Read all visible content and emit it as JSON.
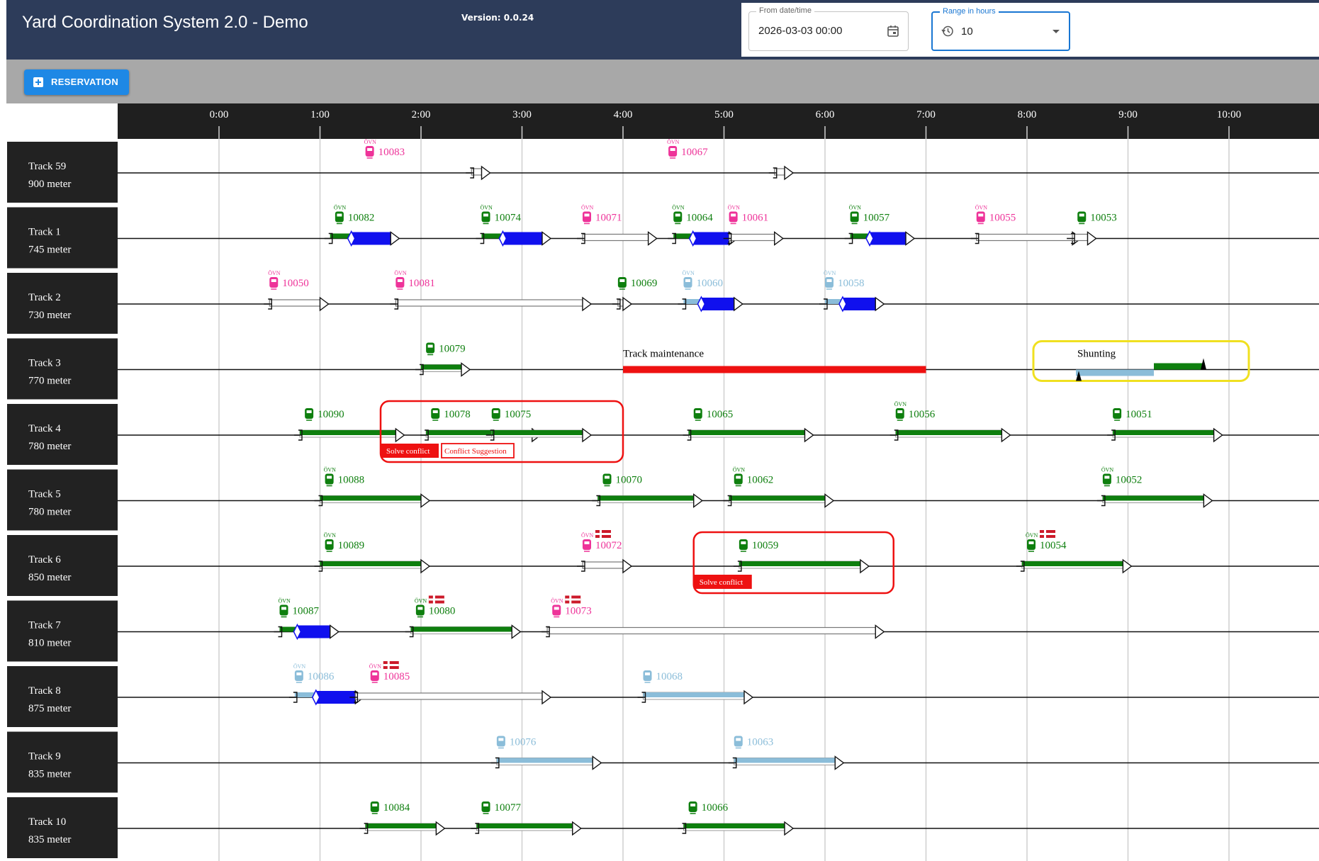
{
  "app": {
    "title": "Yard Coordination System 2.0 - Demo",
    "version": "Version: 0.0.24"
  },
  "controls": {
    "from_label": "From date/time",
    "from_value": "2026-03-03 00:00",
    "range_label": "Range in hours",
    "range_value": "10",
    "reservation_label": "RESERVATION"
  },
  "colors": {
    "header": "#2d3c5a",
    "toolbar": "#a8a8a8",
    "green": "#0e7f0e",
    "blue": "#1010ee",
    "lightblue": "#8bbdd9",
    "pink": "#ee3399",
    "red": "#ee1111",
    "yellow": "#f0e020",
    "tracklabel": "#222222"
  },
  "timeline": {
    "ticks": [
      "0:00",
      "1:00",
      "2:00",
      "3:00",
      "4:00",
      "5:00",
      "6:00",
      "7:00",
      "8:00",
      "9:00",
      "10:00"
    ],
    "start_hour": 0,
    "hours": 11
  },
  "tracks": [
    {
      "name": "Track 59",
      "length": "900 meter",
      "items": [
        {
          "id": "10083",
          "color": "pink",
          "ovn": true,
          "icon": 1.45,
          "start": 2.5,
          "end": 2.6,
          "bar": "white"
        },
        {
          "id": "10067",
          "color": "pink",
          "ovn": true,
          "icon": 4.45,
          "start": 5.5,
          "end": 5.6,
          "bar": "white"
        }
      ]
    },
    {
      "name": "Track 1",
      "length": "745 meter",
      "items": [
        {
          "id": "10082",
          "color": "green",
          "ovn": true,
          "icon": 1.15,
          "start": 1.1,
          "end": 1.7,
          "bar": "green-blue"
        },
        {
          "id": "10074",
          "color": "green",
          "ovn": true,
          "icon": 2.6,
          "start": 2.6,
          "end": 3.2,
          "bar": "green-blue"
        },
        {
          "id": "10071",
          "color": "pink",
          "ovn": true,
          "icon": 3.6,
          "start": 3.6,
          "end": 4.25,
          "bar": "white"
        },
        {
          "id": "10064",
          "color": "green",
          "ovn": true,
          "icon": 4.5,
          "start": 4.5,
          "end": 5.05,
          "bar": "green-blue"
        },
        {
          "id": "10061",
          "color": "pink",
          "ovn": true,
          "icon": 5.05,
          "start": 5.05,
          "end": 5.5,
          "bar": "white"
        },
        {
          "id": "10057",
          "color": "green",
          "ovn": true,
          "icon": 6.25,
          "start": 6.25,
          "end": 6.8,
          "bar": "green-blue"
        },
        {
          "id": "10055",
          "color": "pink",
          "ovn": true,
          "icon": 7.5,
          "start": 7.5,
          "end": 8.45,
          "bar": "white"
        },
        {
          "id": "10053",
          "color": "green",
          "ovn": false,
          "icon": 8.5,
          "start": 8.45,
          "end": 8.6,
          "bar": "white"
        }
      ]
    },
    {
      "name": "Track 2",
      "length": "730 meter",
      "items": [
        {
          "id": "10050",
          "color": "pink",
          "ovn": true,
          "icon": 0.5,
          "start": 0.5,
          "end": 1.0,
          "bar": "white"
        },
        {
          "id": "10081",
          "color": "pink",
          "ovn": true,
          "icon": 1.75,
          "start": 1.75,
          "end": 3.6,
          "bar": "white"
        },
        {
          "id": "10069",
          "color": "green",
          "ovn": false,
          "icon": 3.95,
          "start": 3.95,
          "end": 4.0,
          "bar": "white"
        },
        {
          "id": "10060",
          "color": "lightblue",
          "ovn": true,
          "icon": 4.6,
          "start": 4.6,
          "end": 5.1,
          "bar": "lb-blue"
        },
        {
          "id": "10058",
          "color": "lightblue",
          "ovn": true,
          "icon": 6.0,
          "start": 6.0,
          "end": 6.5,
          "bar": "lb-blue"
        }
      ]
    },
    {
      "name": "Track 3",
      "length": "770 meter",
      "items": [
        {
          "id": "10079",
          "color": "green",
          "ovn": false,
          "icon": 2.05,
          "start": 2.0,
          "end": 2.4,
          "bar": "green"
        }
      ],
      "maintenance": {
        "label": "Track maintenance",
        "start": 4.0,
        "end": 7.0
      },
      "shunting": {
        "label": "Shunting"
      }
    },
    {
      "name": "Track 4",
      "length": "780 meter",
      "items": [
        {
          "id": "10090",
          "color": "green",
          "ovn": false,
          "icon": 0.85,
          "start": 0.8,
          "end": 1.75,
          "bar": "green"
        },
        {
          "id": "10078",
          "color": "green",
          "ovn": false,
          "icon": 2.1,
          "start": 2.05,
          "end": 3.1,
          "bar": "green"
        },
        {
          "id": "10075",
          "color": "green",
          "ovn": false,
          "icon": 2.7,
          "start": 2.7,
          "end": 3.6,
          "bar": "green"
        },
        {
          "id": "10065",
          "color": "green",
          "ovn": false,
          "icon": 4.7,
          "start": 4.65,
          "end": 5.8,
          "bar": "green"
        },
        {
          "id": "10056",
          "color": "green",
          "ovn": true,
          "icon": 6.7,
          "start": 6.7,
          "end": 7.75,
          "bar": "green"
        },
        {
          "id": "10051",
          "color": "green",
          "ovn": false,
          "icon": 8.85,
          "start": 8.85,
          "end": 9.85,
          "bar": "green"
        }
      ],
      "conflict": {
        "label": "Solve conflict",
        "suggestion": "Conflict Suggestion"
      }
    },
    {
      "name": "Track 5",
      "length": "780 meter",
      "items": [
        {
          "id": "10088",
          "color": "green",
          "ovn": true,
          "icon": 1.05,
          "start": 1.0,
          "end": 2.0,
          "bar": "green"
        },
        {
          "id": "10070",
          "color": "green",
          "ovn": false,
          "icon": 3.8,
          "start": 3.75,
          "end": 4.7,
          "bar": "green"
        },
        {
          "id": "10062",
          "color": "green",
          "ovn": true,
          "icon": 5.1,
          "start": 5.05,
          "end": 6.0,
          "bar": "green"
        },
        {
          "id": "10052",
          "color": "green",
          "ovn": true,
          "icon": 8.75,
          "start": 8.75,
          "end": 9.75,
          "bar": "green"
        }
      ]
    },
    {
      "name": "Track 6",
      "length": "850 meter",
      "items": [
        {
          "id": "10089",
          "color": "green",
          "ovn": true,
          "icon": 1.05,
          "start": 1.0,
          "end": 2.0,
          "bar": "green"
        },
        {
          "id": "10072",
          "color": "pink",
          "ovn": true,
          "icon": 3.6,
          "start": 3.6,
          "end": 4.0,
          "bar": "white",
          "flag": true
        },
        {
          "id": "10059",
          "color": "green",
          "ovn": false,
          "icon": 5.15,
          "start": 5.15,
          "end": 6.35,
          "bar": "green"
        },
        {
          "id": "10054",
          "color": "green",
          "ovn": true,
          "icon": 8.0,
          "start": 7.95,
          "end": 8.95,
          "bar": "green",
          "flag": true
        }
      ],
      "conflict": {
        "label": "Solve conflict"
      }
    },
    {
      "name": "Track 7",
      "length": "810 meter",
      "items": [
        {
          "id": "10087",
          "color": "green",
          "ovn": true,
          "icon": 0.6,
          "start": 0.6,
          "end": 1.1,
          "bar": "green-blue"
        },
        {
          "id": "10080",
          "color": "green",
          "ovn": true,
          "icon": 1.95,
          "start": 1.9,
          "end": 2.9,
          "bar": "green",
          "flag": true
        },
        {
          "id": "10073",
          "color": "pink",
          "ovn": true,
          "icon": 3.3,
          "start": 3.25,
          "end": 6.5,
          "bar": "white",
          "flag": true
        }
      ]
    },
    {
      "name": "Track 8",
      "length": "875 meter",
      "items": [
        {
          "id": "10086",
          "color": "lightblue",
          "ovn": true,
          "icon": 0.75,
          "start": 0.75,
          "end": 1.35,
          "bar": "lb-blue"
        },
        {
          "id": "10085",
          "color": "pink",
          "ovn": true,
          "icon": 1.5,
          "start": 1.35,
          "end": 3.2,
          "bar": "white",
          "flag": true
        },
        {
          "id": "10068",
          "color": "lightblue",
          "ovn": false,
          "icon": 4.2,
          "start": 4.2,
          "end": 5.2,
          "bar": "lightblue"
        }
      ]
    },
    {
      "name": "Track 9",
      "length": "835 meter",
      "items": [
        {
          "id": "10076",
          "color": "lightblue",
          "ovn": false,
          "icon": 2.75,
          "start": 2.75,
          "end": 3.7,
          "bar": "lightblue"
        },
        {
          "id": "10063",
          "color": "lightblue",
          "ovn": false,
          "icon": 5.1,
          "start": 5.1,
          "end": 6.1,
          "bar": "lightblue"
        }
      ]
    },
    {
      "name": "Track 10",
      "length": "835 meter",
      "items": [
        {
          "id": "10084",
          "color": "green",
          "ovn": false,
          "icon": 1.5,
          "start": 1.45,
          "end": 2.15,
          "bar": "green"
        },
        {
          "id": "10077",
          "color": "green",
          "ovn": false,
          "icon": 2.6,
          "start": 2.55,
          "end": 3.5,
          "bar": "green"
        },
        {
          "id": "10066",
          "color": "green",
          "ovn": false,
          "icon": 4.65,
          "start": 4.6,
          "end": 5.6,
          "bar": "green"
        }
      ]
    }
  ],
  "ovn_text": "ÖVN"
}
